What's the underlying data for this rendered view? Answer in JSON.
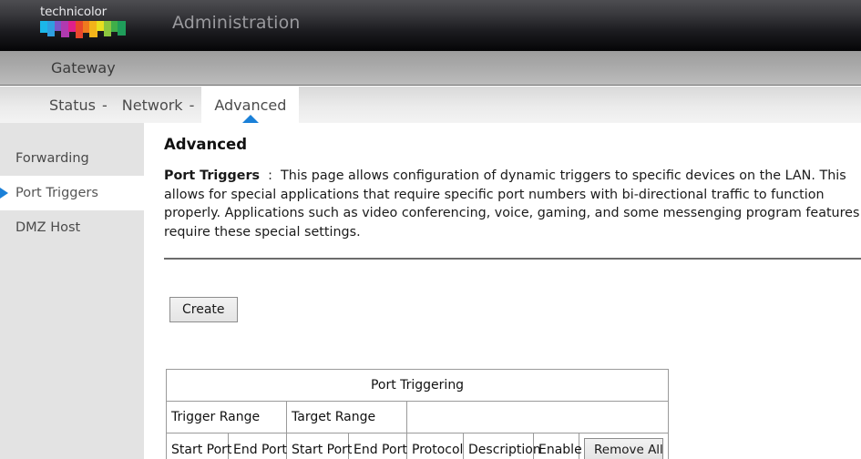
{
  "header": {
    "brand": "technicolor",
    "app_title": "Administration",
    "logo_colors": [
      "#1bb7e8",
      "#2f9fe0",
      "#7b56c9",
      "#b03ab0",
      "#e0208a",
      "#e8472c",
      "#f07a1e",
      "#f2b31a",
      "#e8e020",
      "#8cc63f",
      "#3fae49",
      "#1f9d5a"
    ]
  },
  "section_bar": {
    "label": "Gateway"
  },
  "tabs": [
    {
      "label": "Status",
      "caret": "-",
      "active": false
    },
    {
      "label": "Network",
      "caret": "-",
      "active": false
    },
    {
      "label": "Advanced",
      "caret": "",
      "active": true
    }
  ],
  "sidebar": {
    "items": [
      {
        "label": "Forwarding",
        "active": false
      },
      {
        "label": "Port Triggers",
        "active": true
      },
      {
        "label": "DMZ Host",
        "active": false
      }
    ]
  },
  "main": {
    "page_title": "Advanced",
    "desc_label": "Port Triggers",
    "desc_separator": ":",
    "desc_body": "This page allows configuration of dynamic triggers to specific devices on the LAN. This allows for special applications that require specific port numbers with bi-directional traffic to function properly. Applications such as video conferencing, voice, gaming, and some messenging program features require these special settings.",
    "create_label": "Create"
  },
  "table": {
    "caption": "Port Triggering",
    "group_headers": [
      "Trigger Range",
      "Target Range",
      ""
    ],
    "column_headers": [
      "Start Port",
      "End Port",
      "Start Port",
      "End Port",
      "Protocol",
      "Description",
      "Enable"
    ],
    "remove_all_label": "Remove All",
    "rows": []
  },
  "colors": {
    "accent_blue": "#1a80d8",
    "sidebar_bg": "#e3e3e3",
    "header_dark": "#39393d"
  }
}
